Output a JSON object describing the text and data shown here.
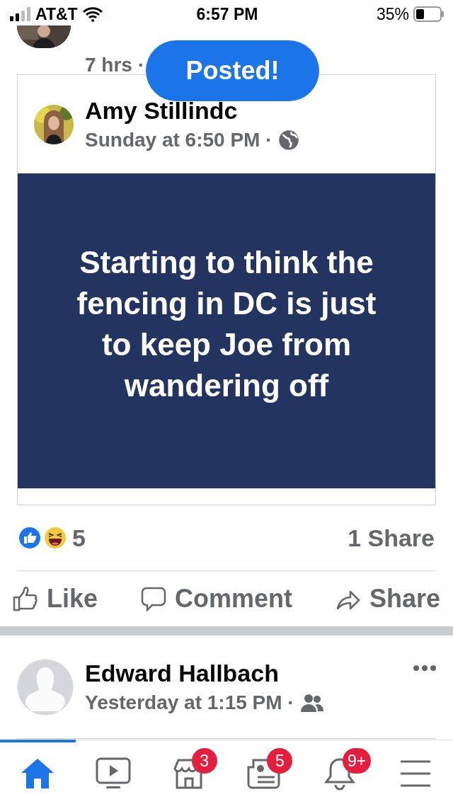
{
  "status_bar": {
    "carrier": "AT&T",
    "time": "6:57 PM",
    "battery": "35%"
  },
  "previous_post": {
    "time": "7 hrs ·"
  },
  "toast": {
    "text": "Posted!"
  },
  "shared_post": {
    "author": "Amy Stillindc",
    "time": "Sunday at 6:50 PM ·",
    "text": "Starting to think the fencing in DC is just to keep Joe from wandering off"
  },
  "reactions": {
    "count": "5",
    "shares": "1 Share"
  },
  "actions": [
    {
      "kind": "like",
      "label": "Like"
    },
    {
      "kind": "comment",
      "label": "Comment"
    },
    {
      "kind": "share",
      "label": "Share"
    }
  ],
  "next_post": {
    "author": "Edward Hallbach",
    "time": "Yesterday at 1:15 PM ·"
  },
  "nav": [
    {
      "kind": "home",
      "selected": true
    },
    {
      "kind": "video",
      "selected": false
    },
    {
      "kind": "market",
      "selected": false,
      "badge": "3"
    },
    {
      "kind": "news",
      "selected": false,
      "badge": "5"
    },
    {
      "kind": "bell",
      "selected": false,
      "badge": "9+"
    },
    {
      "kind": "menu",
      "selected": false
    }
  ]
}
